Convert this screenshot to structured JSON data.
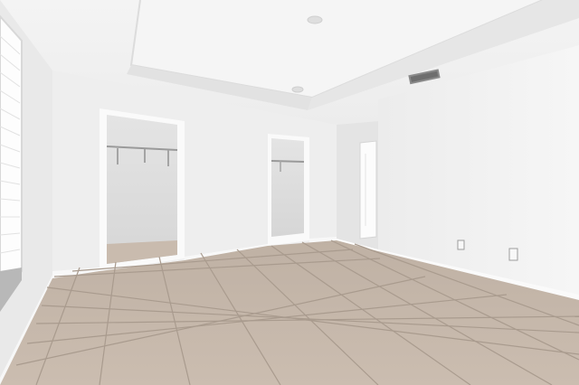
{
  "scene": {
    "description_label": "",
    "palette": {
      "ceiling": "#f3f3f3",
      "wall_left": "#ebebeb",
      "wall_back": "#eeeeee",
      "wall_right": "#f2f2f2",
      "floor": "#c7b9ac",
      "grout": "#a89a8d",
      "closet_interior": "#dcdcdc",
      "trim": "#fafafa",
      "vent": "#7d7d7d"
    },
    "features": [
      "tray-ceiling",
      "walk-in-closet",
      "reach-in-closet",
      "interior-door",
      "window-blinds",
      "tile-floor",
      "air-vent",
      "recessed-lights",
      "wall-outlets"
    ]
  }
}
